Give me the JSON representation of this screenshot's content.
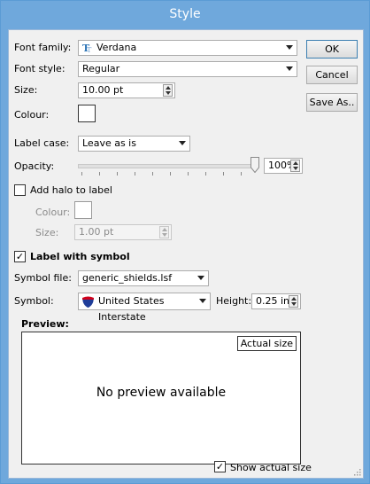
{
  "window": {
    "title": "Style"
  },
  "font": {
    "family_label": "Font family:",
    "family_value": "Verdana",
    "style_label": "Font style:",
    "style_value": "Regular",
    "size_label": "Size:",
    "size_value": "10.00 pt",
    "colour_label": "Colour:"
  },
  "label_case": {
    "label": "Label case:",
    "value": "Leave as is"
  },
  "opacity": {
    "label": "Opacity:",
    "value": "100%",
    "level": 1.0
  },
  "halo": {
    "checkbox_label": "Add halo to label",
    "checked": false,
    "colour_label": "Colour:",
    "size_label": "Size:",
    "size_value": "1.00 pt"
  },
  "symbol": {
    "checkbox_label": "Label with symbol",
    "checked": true,
    "check_mark": "✓",
    "file_label": "Symbol file:",
    "file_value": "generic_shields.lsf",
    "symbol_label": "Symbol:",
    "symbol_value": "United States Interstate",
    "height_label": "Height:",
    "height_value": "0.25 in"
  },
  "preview": {
    "label": "Preview:",
    "actual_size_button": "Actual size",
    "empty_text": "No preview available",
    "show_actual_size_label": "Show actual size",
    "show_actual_size_checked": true,
    "check_mark": "✓"
  },
  "buttons": {
    "ok": "OK",
    "cancel": "Cancel",
    "save_as": "Save As.."
  },
  "colors": {
    "title_bar": "#6fa8dc",
    "dialog_bg": "#f0f0f0",
    "font_icon": "#2e75b6",
    "shield_blue": "#1f3d99",
    "shield_red": "#d0021b"
  },
  "icons": {
    "font_family": "truetype-font-icon",
    "symbol": "interstate-shield-icon"
  }
}
